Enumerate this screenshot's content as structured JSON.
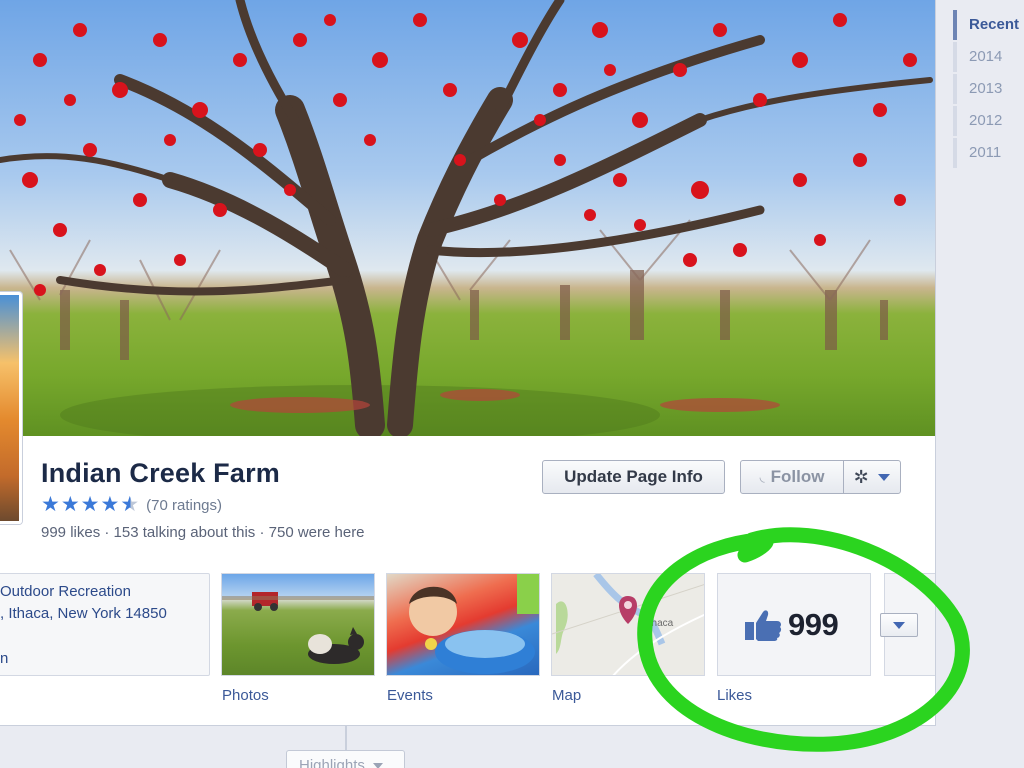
{
  "page": {
    "name": "Indian Creek Farm",
    "rating_stars": 4.5,
    "ratings_text": "(70 ratings)",
    "stats_text": "999 likes · 153 talking about this · 750 were here"
  },
  "buttons": {
    "update_page_info": "Update Page Info",
    "follow": "Follow"
  },
  "about": {
    "category": "Outdoor Recreation",
    "address": ", Ithaca, New York 14850",
    "line3": "n"
  },
  "tiles": {
    "photos_label": "Photos",
    "events_label": "Events",
    "map_label": "Map",
    "map_city": "Ithaca",
    "likes_label": "Likes",
    "likes_count": "999"
  },
  "timeline": {
    "items": [
      "Recent",
      "2014",
      "2013",
      "2012",
      "2011"
    ],
    "active": "Recent"
  },
  "highlights_label": "Highlights",
  "icons": {
    "star": "star-icon",
    "rss": "rss-icon",
    "gear": "gear-icon",
    "thumbs_up": "thumbs-up-icon",
    "chevron": "chevron-down-icon"
  },
  "colors": {
    "link": "#3b5998",
    "annotation": "#2bd41f",
    "star": "#3b79d8"
  }
}
